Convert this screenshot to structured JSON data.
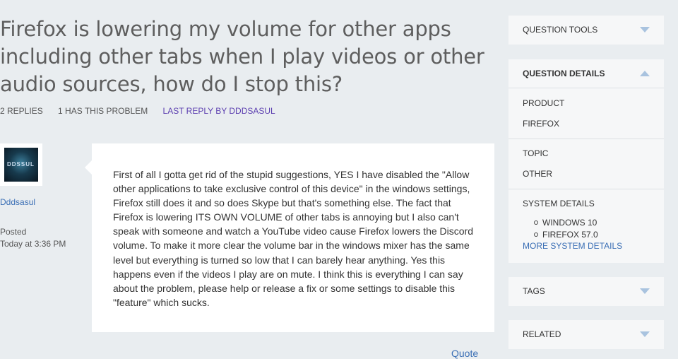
{
  "question": {
    "title": "Firefox is lowering my volume for other apps including other tabs when I play videos or other audio sources, how do I stop this?",
    "replies": "2 REPLIES",
    "has_problem": "1 HAS THIS PROBLEM",
    "last_reply": "LAST REPLY BY DDDSASUL"
  },
  "post": {
    "avatar_text": "DDSSUL",
    "username": "Dddsasul",
    "posted_label": "Posted",
    "posted_time": "Today at 3:36 PM",
    "body": "First of all I gotta get rid of the stupid suggestions, YES I have disabled the \"Allow other applications to take exclusive control of this device\" in the windows settings, Firefox still does it and so does Skype but that's something else. The fact that Firefox is lowering ITS OWN VOLUME of other tabs is annoying but I also can't speak with someone and watch a YouTube video cause Firefox lowers the Discord volume. To make it more clear the volume bar in the windows mixer has the same level but everything is turned so low that I can barely hear anything. Yes this happens even if the videos I play are on mute. I think this is everything I can say about the problem, please help or release a fix or some settings to disable this \"feature\" which sucks.",
    "quote_label": "Quote"
  },
  "sidebar": {
    "question_tools": "QUESTION TOOLS",
    "question_details": "QUESTION DETAILS",
    "product_label": "PRODUCT",
    "product_value": "FIREFOX",
    "topic_label": "TOPIC",
    "topic_value": "OTHER",
    "system_details_label": "SYSTEM DETAILS",
    "system_items": [
      "WINDOWS 10",
      "FIREFOX 57.0"
    ],
    "more_system_details": "MORE SYSTEM DETAILS",
    "tags": "TAGS",
    "related": "RELATED"
  },
  "colors": {
    "background": "#e9edf0",
    "link": "#3b6fb5",
    "last_reply": "#5c3fb0",
    "toggle_arrow": "#a9c3df"
  }
}
